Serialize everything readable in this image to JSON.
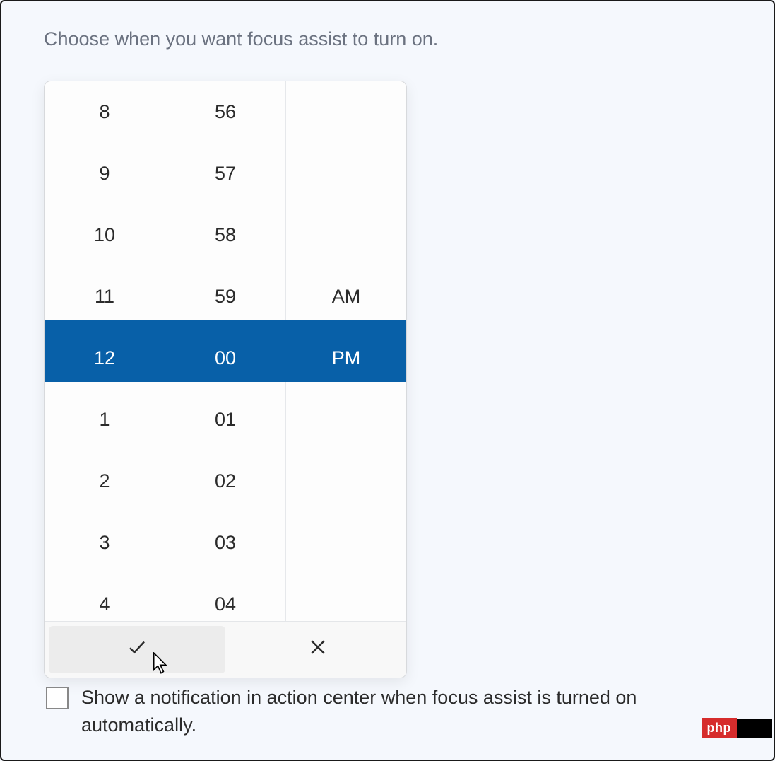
{
  "heading": "Choose when you want focus assist to turn on.",
  "timePicker": {
    "hours": [
      "8",
      "9",
      "10",
      "11",
      "12",
      "1",
      "2",
      "3",
      "4"
    ],
    "minutes": [
      "56",
      "57",
      "58",
      "59",
      "00",
      "01",
      "02",
      "03",
      "04"
    ],
    "periods_before": [
      "",
      "",
      "",
      "AM"
    ],
    "periods_selected": "PM",
    "periods_after": [
      "",
      "",
      "",
      ""
    ],
    "selectedIndex": 4,
    "selected": {
      "hour": "12",
      "minute": "00",
      "period": "PM"
    }
  },
  "checkbox": {
    "checked": false,
    "label": "Show a notification in action center when focus assist is turned on automatically."
  },
  "watermark": {
    "text": "php"
  }
}
